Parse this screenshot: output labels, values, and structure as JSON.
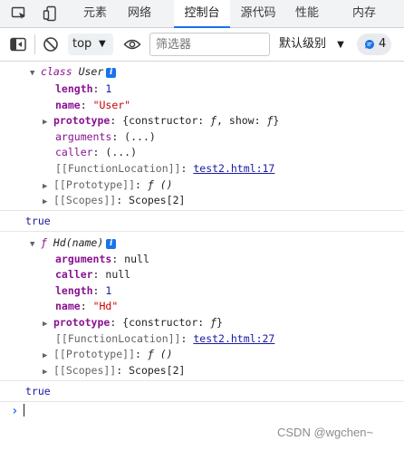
{
  "tabs": [
    {
      "label": "元素"
    },
    {
      "label": "网络"
    },
    {
      "label": "控制台"
    },
    {
      "label": "源代码"
    },
    {
      "label": "性能"
    },
    {
      "label": "内存"
    }
  ],
  "toolbar": {
    "context": "top",
    "filter_placeholder": "筛选器",
    "levels": "默认级别",
    "issues_count": "4"
  },
  "console": {
    "group1": {
      "kw": "class",
      "name": "User",
      "length_key": "length",
      "length_val": "1",
      "name_key": "name",
      "name_val": "\"User\"",
      "proto_key": "prototype",
      "proto_val": "{constructor: ",
      "proto_f": "ƒ",
      "proto_mid": ", show: ",
      "proto_f2": "ƒ",
      "proto_end": "}",
      "args_key": "arguments",
      "args_val": "(...)",
      "caller_key": "caller",
      "caller_val": "(...)",
      "loc_key": "[[FunctionLocation]]",
      "loc_val": "test2.html:17",
      "pp_key": "[[Prototype]]",
      "pp_val": "ƒ ()",
      "scopes_key": "[[Scopes]]",
      "scopes_val": "Scopes[2]"
    },
    "result1": "true",
    "group2": {
      "kw": "ƒ",
      "name": "Hd(name)",
      "args_key": "arguments",
      "args_val": "null",
      "caller_key": "caller",
      "caller_val": "null",
      "length_key": "length",
      "length_val": "1",
      "name_key": "name",
      "name_val": "\"Hd\"",
      "proto_key": "prototype",
      "proto_val": "{constructor: ",
      "proto_f": "ƒ",
      "proto_end": "}",
      "loc_key": "[[FunctionLocation]]",
      "loc_val": "test2.html:27",
      "pp_key": "[[Prototype]]",
      "pp_val": "ƒ ()",
      "scopes_key": "[[Scopes]]",
      "scopes_val": "Scopes[2]"
    },
    "result2": "true",
    "prompt": "›"
  },
  "watermark": "CSDN @wgchen~",
  "colors": {
    "accent": "#1a73e8",
    "keyword": "#881391",
    "string": "#c80000",
    "number": "#1a1aa6"
  }
}
